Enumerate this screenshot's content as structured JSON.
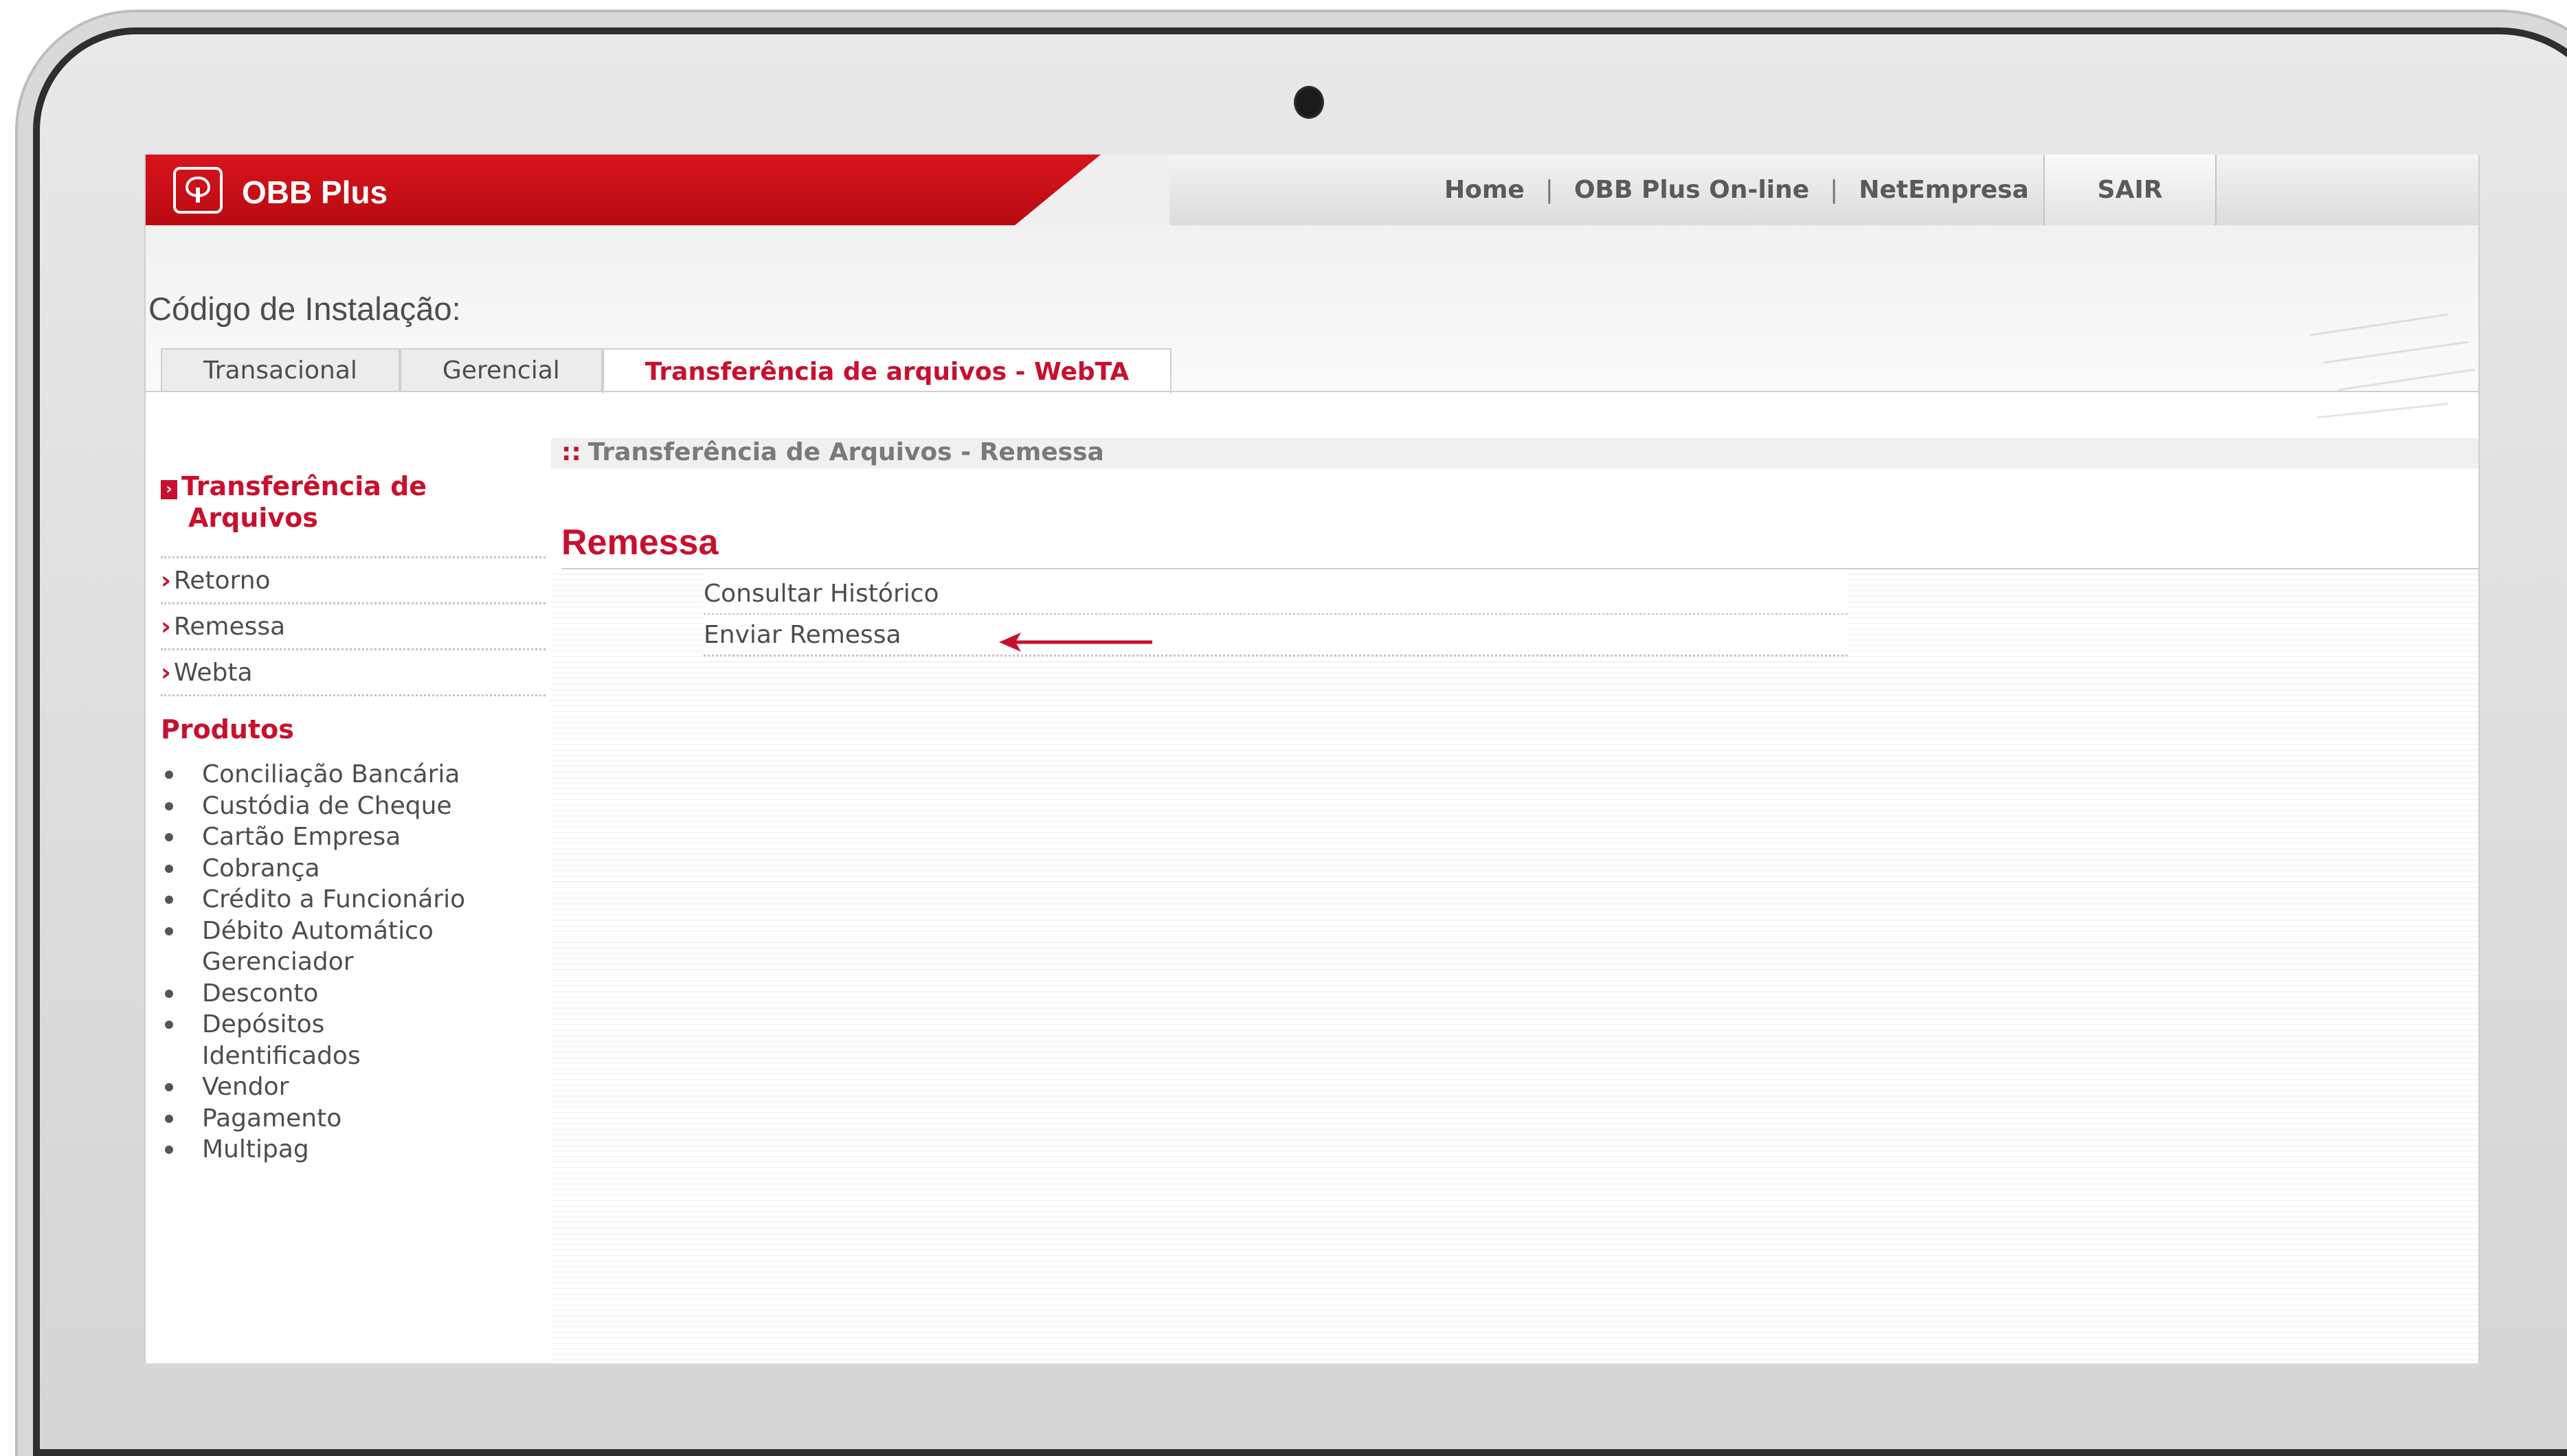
{
  "header": {
    "brand": "OBB Plus",
    "nav": [
      "Home",
      "OBB Plus On-line",
      "NetEmpresa"
    ],
    "logout": "SAIR"
  },
  "install_label": "Código de Instalação:",
  "tabs": [
    {
      "label": "Transacional",
      "active": false
    },
    {
      "label": "Gerencial",
      "active": false
    },
    {
      "label": "Transferência de arquivos - WebTA",
      "active": true
    }
  ],
  "sidebar": {
    "title_line1": "Transferência de",
    "title_line2": "Arquivos",
    "items": [
      "Retorno",
      "Remessa",
      "Webta"
    ],
    "products_title": "Produtos",
    "products": [
      "Conciliação Bancária",
      "Custódia de Cheque",
      "Cartão Empresa",
      "Cobrança",
      "Crédito a Funcionário",
      "Débito Automático",
      "Gerenciador",
      "Desconto",
      "Depósitos",
      "Identificados",
      "Vendor",
      "Pagamento",
      "Multipag"
    ]
  },
  "main": {
    "breadcrumb": "Transferência de Arquivos - Remessa",
    "title": "Remessa",
    "actions": [
      "Consultar Histórico",
      "Enviar Remessa"
    ]
  },
  "colors": {
    "brand_red": "#c8102e",
    "text_gray": "#4d4d4d"
  }
}
